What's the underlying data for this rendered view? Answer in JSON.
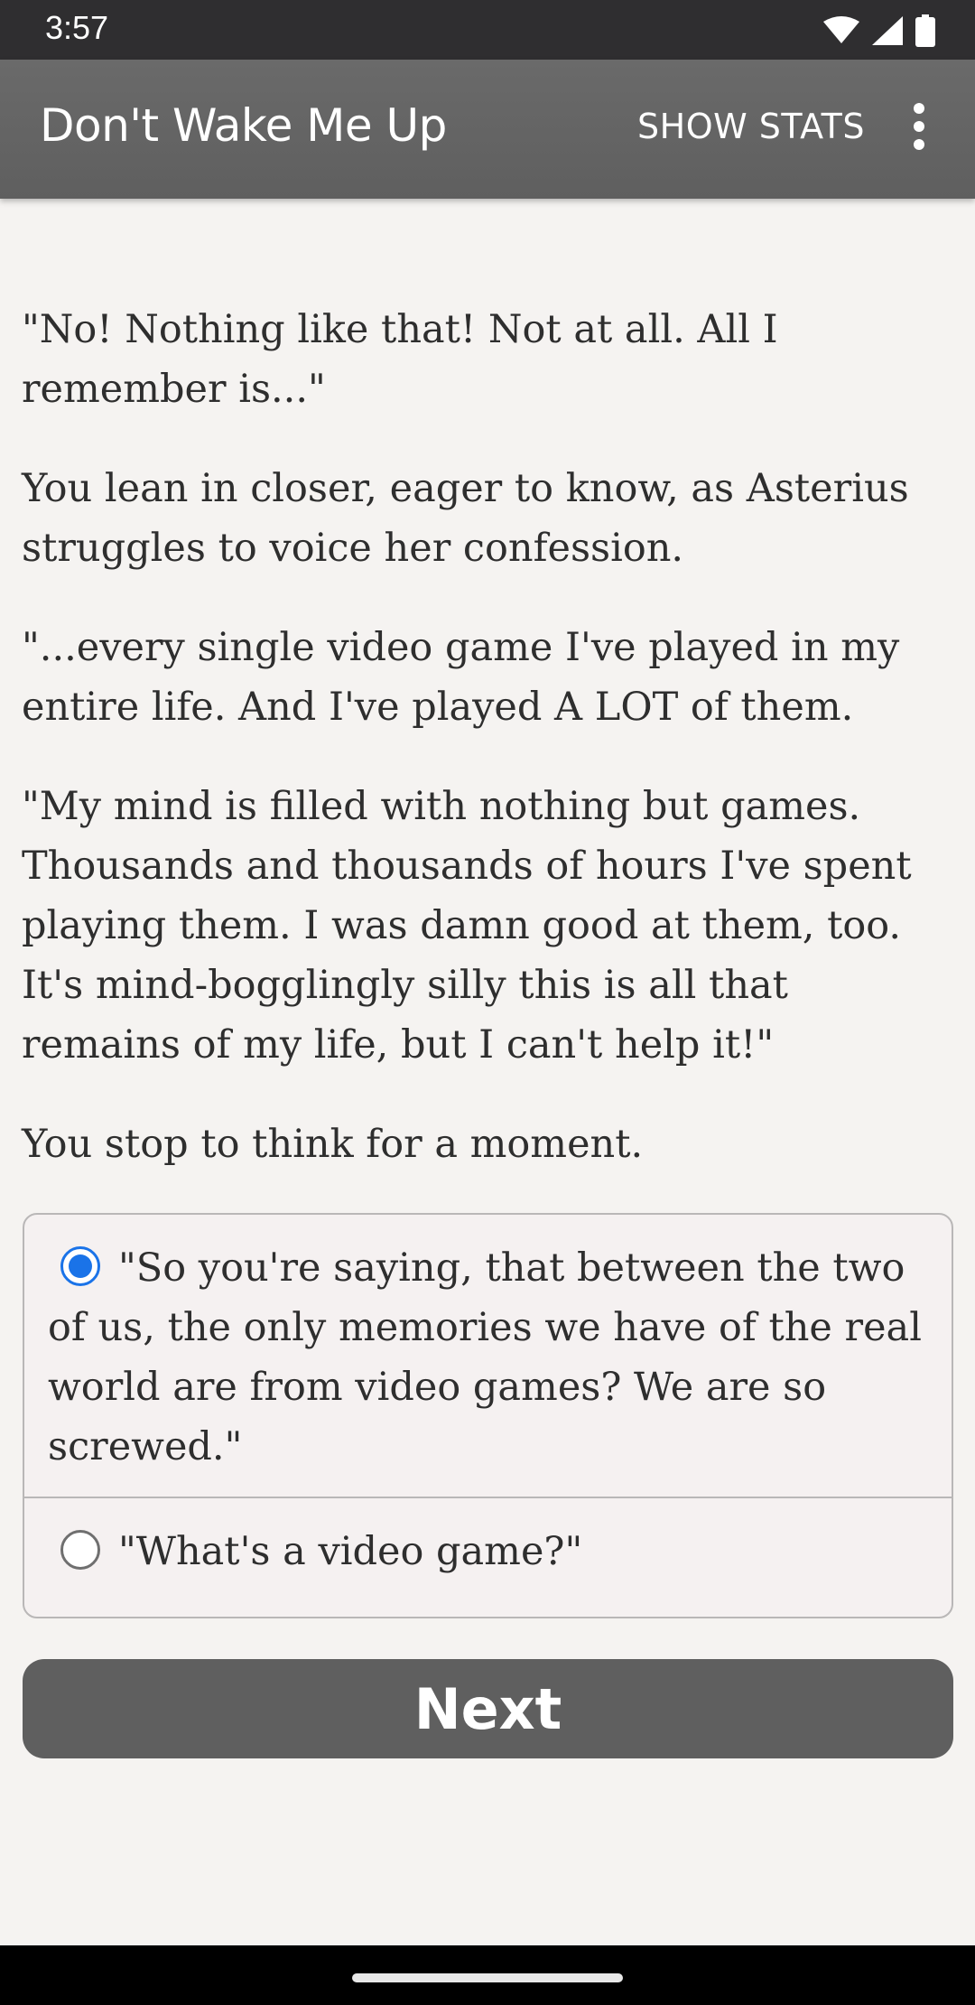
{
  "status_bar": {
    "time": "3:57",
    "icons": [
      "wifi-icon",
      "cell-signal-icon",
      "battery-icon"
    ]
  },
  "app_bar": {
    "title": "Don't Wake Me Up",
    "show_stats_label": "SHOW STATS",
    "menu_icon": "more-vert-icon"
  },
  "story": {
    "paragraphs": [
      "\"No! Nothing like that! Not at all. All I remember is...\"",
      "You lean in closer, eager to know, as Asterius struggles to voice her confession.",
      "\"...every single video game I've played in my entire life. And I've played A LOT of them.",
      "\"My mind is filled with nothing but games. Thousands and thousands of hours I've spent playing them. I was damn good at them, too. It's mind-bogglingly silly this is all that remains of my life, but I can't help it!\"",
      "You stop to think for a moment."
    ]
  },
  "choices": [
    {
      "text": "\"So you're saying, that between the two of us, the only memories we have of the real world are from video games? We are so screwed.\"",
      "selected": true
    },
    {
      "text": "\"What's a video game?\"",
      "selected": false
    }
  ],
  "next_label": "Next",
  "colors": {
    "app_bar": "#636363",
    "background": "#f5f3f1",
    "accent": "#1a73e8",
    "button": "#5f5f5f"
  }
}
